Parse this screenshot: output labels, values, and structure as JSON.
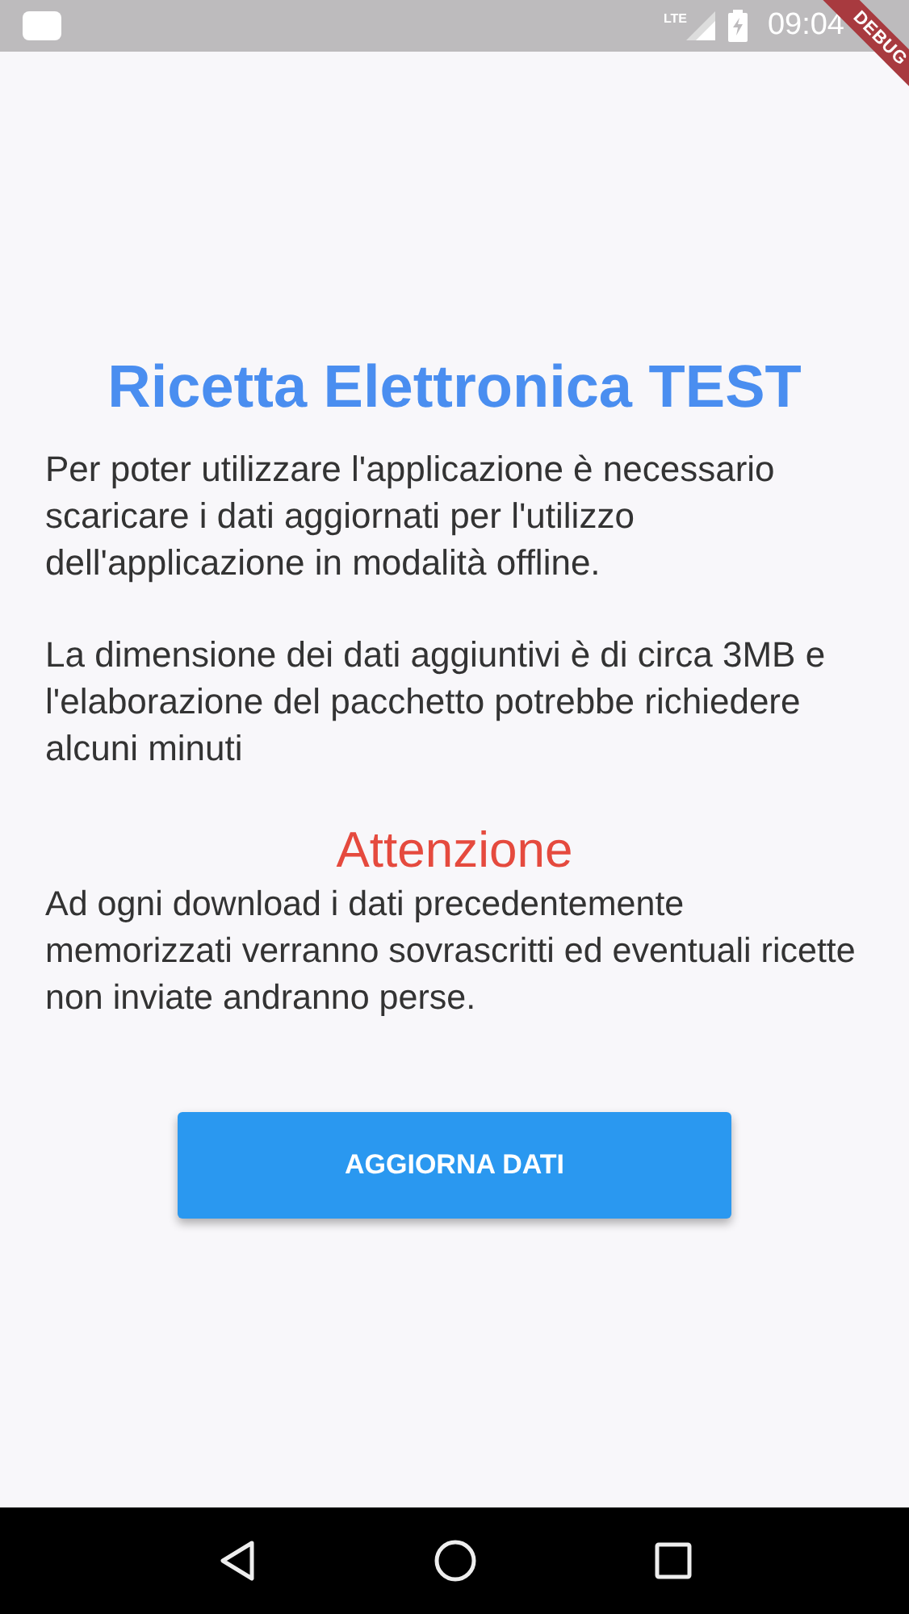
{
  "status_bar": {
    "network": "LTE",
    "time": "09:04"
  },
  "debug_banner": "DEBUG",
  "title": "Ricetta Elettronica TEST",
  "paragraphs": [
    "Per poter utilizzare l'applicazione è necessario scaricare i dati aggiornati per l'utilizzo dell'applicazione in modalità offline.",
    "La dimensione dei dati aggiuntivi è di circa 3MB e l'elaborazione del pacchetto potrebbe richiedere alcuni minuti"
  ],
  "warning": {
    "heading": "Attenzione",
    "text": "Ad ogni download i dati precedentemente memorizzati verranno sovrascritti ed eventuali ricette non inviate andranno perse."
  },
  "button": "AGGIORNA DATI"
}
